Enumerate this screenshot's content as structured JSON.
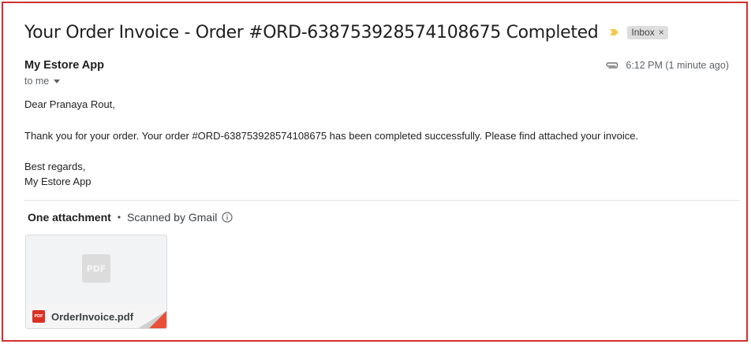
{
  "email": {
    "subject": "Your Order Invoice - Order #ORD-638753928574108675 Completed",
    "label": "Inbox",
    "label_remove": "×",
    "sender": "My Estore App",
    "recipient": "to me",
    "time": "6:12 PM (1 minute ago)",
    "body": {
      "greeting": "Dear Pranaya Rout,",
      "message": "Thank you for your order. Your order #ORD-638753928574108675 has been completed successfully. Please find attached your invoice.",
      "closing": "Best regards,",
      "signature": "My Estore App"
    }
  },
  "attachments": {
    "count_label": "One attachment",
    "separator": "•",
    "scan_label": "Scanned by Gmail",
    "items": [
      {
        "filename": "OrderInvoice.pdf",
        "type_badge": "PDF",
        "icon": "pdf-icon"
      }
    ]
  },
  "colors": {
    "frame": "#d32f2f",
    "importance": "#f2c94c",
    "pdf": "#d93025"
  }
}
